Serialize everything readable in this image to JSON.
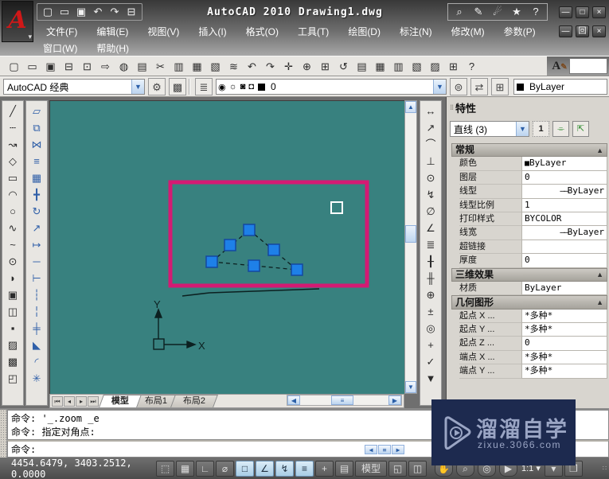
{
  "title_bar": {
    "title": "AutoCAD 2010  Drawing1.dwg",
    "logo": "A",
    "quick_access": [
      {
        "name": "new-file-icon",
        "glyph": "▢"
      },
      {
        "name": "open-file-icon",
        "glyph": "▭"
      },
      {
        "name": "save-icon",
        "glyph": "▣"
      },
      {
        "name": "undo-icon",
        "glyph": "↶"
      },
      {
        "name": "redo-icon",
        "glyph": "↷"
      },
      {
        "name": "plot-icon",
        "glyph": "⊟"
      }
    ],
    "infocenter": [
      {
        "name": "search-icon",
        "glyph": "⌕"
      },
      {
        "name": "wrench-icon",
        "glyph": "✎"
      },
      {
        "name": "communication-center-icon",
        "glyph": "☄"
      },
      {
        "name": "favorites-star-icon",
        "glyph": "★"
      },
      {
        "name": "help-icon",
        "glyph": "?"
      }
    ],
    "app_controls": [
      {
        "name": "minimize-button",
        "glyph": "—"
      },
      {
        "name": "maximize-button",
        "glyph": "□"
      },
      {
        "name": "close-button",
        "glyph": "×"
      }
    ]
  },
  "menus": {
    "row1": [
      "文件(F)",
      "编辑(E)",
      "视图(V)",
      "插入(I)",
      "格式(O)",
      "工具(T)",
      "绘图(D)",
      "标注(N)",
      "修改(M)",
      "参数(P)"
    ],
    "row2": [
      "窗口(W)",
      "帮助(H)"
    ],
    "doc_controls": [
      {
        "name": "doc-minimize-button",
        "glyph": "—"
      },
      {
        "name": "doc-restore-button",
        "glyph": "回"
      },
      {
        "name": "doc-close-button",
        "glyph": "×"
      }
    ]
  },
  "std_toolbar": [
    {
      "name": "new-icon",
      "glyph": "▢"
    },
    {
      "name": "open-icon",
      "glyph": "▭"
    },
    {
      "name": "save-icon",
      "glyph": "▣"
    },
    {
      "name": "print-icon",
      "glyph": "⊟"
    },
    {
      "name": "print-preview-icon",
      "glyph": "⊡"
    },
    {
      "name": "publish-icon",
      "glyph": "⇨"
    },
    {
      "name": "web-icon",
      "glyph": "◍"
    },
    {
      "name": "markup-icon",
      "glyph": "▤"
    },
    {
      "name": "cut-icon",
      "glyph": "✂"
    },
    {
      "name": "copy-icon",
      "glyph": "▥"
    },
    {
      "name": "paste-icon",
      "glyph": "▦"
    },
    {
      "name": "paste-block-icon",
      "glyph": "▧"
    },
    {
      "name": "match-properties-icon",
      "glyph": "≋"
    },
    {
      "name": "undo-icon",
      "glyph": "↶"
    },
    {
      "name": "redo-icon",
      "glyph": "↷"
    },
    {
      "name": "pan-icon",
      "glyph": "✛"
    },
    {
      "name": "zoom-realtime-icon",
      "glyph": "⊕"
    },
    {
      "name": "zoom-window-icon",
      "glyph": "⊞"
    },
    {
      "name": "zoom-previous-icon",
      "glyph": "↺"
    },
    {
      "name": "properties-icon",
      "glyph": "▤"
    },
    {
      "name": "designcenter-icon",
      "glyph": "▦"
    },
    {
      "name": "tool-palettes-icon",
      "glyph": "▥"
    },
    {
      "name": "sheetset-manager-icon",
      "glyph": "▧"
    },
    {
      "name": "markup-set-icon",
      "glyph": "▨"
    },
    {
      "name": "quickcalc-icon",
      "glyph": "⊞"
    },
    {
      "name": "help-icon",
      "glyph": "?"
    }
  ],
  "workspace_bar": {
    "workspace": "AutoCAD 经典",
    "gear_glyph": "⚙",
    "workspace_btn_glyph": "▩",
    "layer_manager_glyph": "≣",
    "layer_states": [
      {
        "name": "bulb-icon",
        "glyph": "◉"
      },
      {
        "name": "sun-icon",
        "glyph": "☼"
      },
      {
        "name": "viewport-freeze-icon",
        "glyph": "◙"
      },
      {
        "name": "lock-icon",
        "glyph": "◘"
      }
    ],
    "layer_name": "0",
    "layer_tools": [
      {
        "name": "make-layer-current-icon",
        "glyph": "⊜"
      },
      {
        "name": "layer-previous-icon",
        "glyph": "⇄"
      },
      {
        "name": "layer-states-icon",
        "glyph": "⊞"
      }
    ],
    "color_value": "ByLayer"
  },
  "draw_toolbar": [
    {
      "name": "line-icon",
      "glyph": "╱"
    },
    {
      "name": "construction-line-icon",
      "glyph": "┄"
    },
    {
      "name": "polyline-icon",
      "glyph": "↝"
    },
    {
      "name": "polygon-icon",
      "glyph": "◇"
    },
    {
      "name": "rectangle-icon",
      "glyph": "▭"
    },
    {
      "name": "arc-icon",
      "glyph": "◠"
    },
    {
      "name": "circle-icon",
      "glyph": "○"
    },
    {
      "name": "revcloud-icon",
      "glyph": "∿"
    },
    {
      "name": "spline-icon",
      "glyph": "~"
    },
    {
      "name": "ellipse-icon",
      "glyph": "⊙"
    },
    {
      "name": "ellipse-arc-icon",
      "glyph": "◗"
    },
    {
      "name": "insert-block-icon",
      "glyph": "▣"
    },
    {
      "name": "make-block-icon",
      "glyph": "◫"
    },
    {
      "name": "point-icon",
      "glyph": "▪"
    },
    {
      "name": "hatch-icon",
      "glyph": "▨"
    },
    {
      "name": "gradient-icon",
      "glyph": "▩"
    },
    {
      "name": "region-icon",
      "glyph": "◰"
    }
  ],
  "modify_toolbar": [
    {
      "name": "erase-icon",
      "glyph": "▱"
    },
    {
      "name": "copy-icon",
      "glyph": "⧉"
    },
    {
      "name": "mirror-icon",
      "glyph": "⋈"
    },
    {
      "name": "offset-icon",
      "glyph": "≡"
    },
    {
      "name": "array-icon",
      "glyph": "▦"
    },
    {
      "name": "move-icon",
      "glyph": "╋"
    },
    {
      "name": "rotate-icon",
      "glyph": "↻"
    },
    {
      "name": "scale-icon",
      "glyph": "↗"
    },
    {
      "name": "stretch-icon",
      "glyph": "↦"
    },
    {
      "name": "trim-icon",
      "glyph": "─"
    },
    {
      "name": "extend-icon",
      "glyph": "⊢"
    },
    {
      "name": "break-at-point-icon",
      "glyph": "┆"
    },
    {
      "name": "break-icon",
      "glyph": "╎"
    },
    {
      "name": "join-icon",
      "glyph": "╪"
    },
    {
      "name": "chamfer-icon",
      "glyph": "◣"
    },
    {
      "name": "fillet-icon",
      "glyph": "◜"
    },
    {
      "name": "explode-icon",
      "glyph": "✳"
    }
  ],
  "dimension_toolbar": [
    {
      "name": "linear-dimension-icon",
      "glyph": "↔"
    },
    {
      "name": "aligned-dimension-icon",
      "glyph": "↗"
    },
    {
      "name": "arc-length-icon",
      "glyph": "⌒"
    },
    {
      "name": "ordinate-icon",
      "glyph": "⊥"
    },
    {
      "name": "radius-icon",
      "glyph": "⊙"
    },
    {
      "name": "jogged-icon",
      "glyph": "↯"
    },
    {
      "name": "diameter-icon",
      "glyph": "∅"
    },
    {
      "name": "angular-icon",
      "glyph": "∠"
    },
    {
      "name": "quick-dimension-icon",
      "glyph": "≣"
    },
    {
      "name": "baseline-icon",
      "glyph": "╂"
    },
    {
      "name": "continue-icon",
      "glyph": "╫"
    },
    {
      "name": "tolerance-icon",
      "glyph": "⊕"
    },
    {
      "name": "center-mark-icon",
      "glyph": "±"
    },
    {
      "name": "dimension-edit-icon",
      "glyph": "◎"
    },
    {
      "name": "dimension-text-edit-icon",
      "glyph": "+"
    },
    {
      "name": "dimension-update-icon",
      "glyph": "✓"
    },
    {
      "name": "dim-style-icon",
      "glyph": "▼"
    }
  ],
  "canvas": {
    "ucs_y_label": "Y",
    "ucs_x_label": "X",
    "colors": {
      "background": "#38817f",
      "selection_window": "#d41a73",
      "grip_fill": "#1e80e8",
      "grip_border": "#1348a0"
    }
  },
  "layout_tabs": {
    "nav": [
      {
        "name": "first-tab-button",
        "glyph": "⏮"
      },
      {
        "name": "prev-tab-button",
        "glyph": "◂"
      },
      {
        "name": "next-tab-button",
        "glyph": "▸"
      },
      {
        "name": "last-tab-button",
        "glyph": "⏭"
      }
    ],
    "tabs": [
      {
        "label": "模型",
        "active": true
      },
      {
        "label": "布局1",
        "active": false
      },
      {
        "label": "布局2",
        "active": false
      }
    ]
  },
  "properties_palette": {
    "title": "特性",
    "selector": "直线 (3)",
    "pickadd_label": "1",
    "buttons": [
      {
        "name": "select-objects-button",
        "glyph": "⌯"
      },
      {
        "name": "quick-select-button",
        "glyph": "⇱"
      }
    ],
    "entries": [
      {
        "type": "section",
        "label": "常规"
      },
      {
        "type": "row",
        "label": "颜色",
        "value": "ByLayer",
        "deco": "swatch"
      },
      {
        "type": "row",
        "label": "图层",
        "value": "0"
      },
      {
        "type": "row",
        "label": "线型",
        "value": "ByLayer",
        "deco": "line"
      },
      {
        "type": "row",
        "label": "线型比例",
        "value": "1"
      },
      {
        "type": "row",
        "label": "打印样式",
        "value": "BYCOLOR"
      },
      {
        "type": "row",
        "label": "线宽",
        "value": "ByLayer",
        "deco": "line"
      },
      {
        "type": "row",
        "label": "超链接",
        "value": ""
      },
      {
        "type": "row",
        "label": "厚度",
        "value": "0"
      },
      {
        "type": "section",
        "label": "三维效果"
      },
      {
        "type": "row",
        "label": "材质",
        "value": "ByLayer"
      },
      {
        "type": "section",
        "label": "几何图形"
      },
      {
        "type": "row",
        "label": "起点 X ...",
        "value": "*多种*"
      },
      {
        "type": "row",
        "label": "起点 Y ...",
        "value": "*多种*"
      },
      {
        "type": "row",
        "label": "起点 Z ...",
        "value": "0"
      },
      {
        "type": "row",
        "label": "端点 X ...",
        "value": "*多种*"
      },
      {
        "type": "row",
        "label": "端点 Y ...",
        "value": "*多种*"
      }
    ]
  },
  "command_window": {
    "history": [
      "命令: '_.zoom _e",
      "命令: 指定对角点:"
    ],
    "prompt": "命令:"
  },
  "status_bar": {
    "coords": "4454.6479, 3403.2512, 0.0000",
    "toggles": [
      {
        "name": "snap-toggle",
        "glyph": "⬚",
        "on": false
      },
      {
        "name": "grid-toggle",
        "glyph": "▦",
        "on": false
      },
      {
        "name": "ortho-toggle",
        "glyph": "∟",
        "on": false
      },
      {
        "name": "polar-toggle",
        "glyph": "⌀",
        "on": false
      },
      {
        "name": "osnap-toggle",
        "glyph": "□",
        "on": true
      },
      {
        "name": "otrack-toggle",
        "glyph": "∠",
        "on": true
      },
      {
        "name": "dynamic-input-toggle",
        "glyph": "↯",
        "on": true
      },
      {
        "name": "lineweight-toggle",
        "glyph": "≡",
        "on": true
      },
      {
        "name": "crosshair-toggle",
        "glyph": "+",
        "on": false
      },
      {
        "name": "quick-properties-toggle",
        "glyph": "▤",
        "on": false
      }
    ],
    "model_button": "模型",
    "layout_icons": [
      {
        "name": "layout-preview-icon",
        "glyph": "◱"
      },
      {
        "name": "layout-switch-icon",
        "glyph": "◫"
      }
    ],
    "nav_icons": [
      {
        "name": "pan-icon",
        "glyph": "✋"
      },
      {
        "name": "zoom-icon",
        "glyph": "⌕"
      },
      {
        "name": "steering-wheel-icon",
        "glyph": "◎"
      },
      {
        "name": "show-motion-icon",
        "glyph": "▶"
      }
    ],
    "annotation_scale": "1:1 ▾",
    "tray_icons": [
      {
        "name": "workspace-switch-icon",
        "glyph": "▾"
      },
      {
        "name": "app-window-icon",
        "glyph": "❐"
      }
    ]
  },
  "watermark": {
    "brand": "溜溜自学",
    "url": "zixue.3066.com"
  }
}
